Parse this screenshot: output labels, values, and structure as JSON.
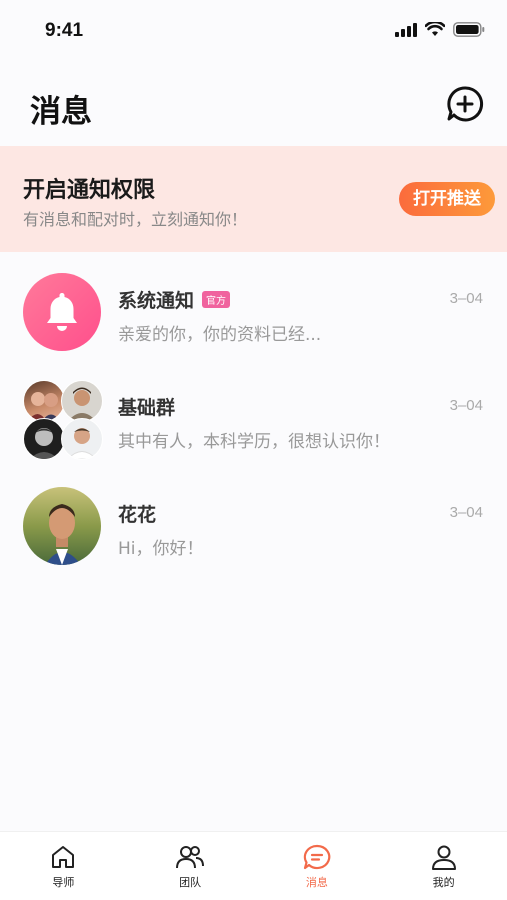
{
  "status": {
    "time": "9:41"
  },
  "header": {
    "title": "消息"
  },
  "notice": {
    "title": "开启通知权限",
    "subtitle": "有消息和配对时，立刻通知你！",
    "button": "打开推送",
    "accent": "#fb6b3c"
  },
  "conversations": [
    {
      "name": "系统通知",
      "badge": "官方",
      "preview": "亲爱的你，你的资料已经...",
      "date": "3–04",
      "avatar": "bell-icon"
    },
    {
      "name": "基础群",
      "preview": "其中有人，本科学历，很想认识你！",
      "date": "3–04",
      "avatar": "group-avatar"
    },
    {
      "name": "花花",
      "preview": "Hi，你好！",
      "date": "3–04",
      "avatar": "user-photo"
    }
  ],
  "tabs": [
    {
      "label": "导师",
      "icon": "home-icon"
    },
    {
      "label": "团队",
      "icon": "team-icon"
    },
    {
      "label": "消息",
      "icon": "message-icon",
      "active": true
    },
    {
      "label": "我的",
      "icon": "profile-icon"
    }
  ]
}
